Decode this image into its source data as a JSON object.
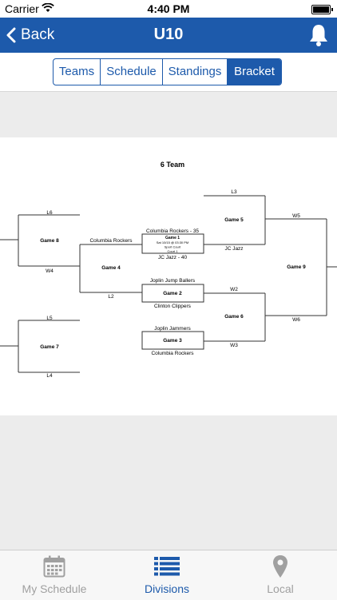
{
  "status_bar": {
    "carrier": "Carrier",
    "time": "4:40 PM"
  },
  "navbar": {
    "back_label": "Back",
    "title": "U10"
  },
  "segments": [
    {
      "label": "Teams",
      "active": false
    },
    {
      "label": "Schedule",
      "active": false
    },
    {
      "label": "Standings",
      "active": false
    },
    {
      "label": "Bracket",
      "active": true
    }
  ],
  "bracket": {
    "title": "6 Team",
    "games": {
      "game8": "Game 8",
      "game4": "Game 4",
      "game7": "Game 7",
      "game1": "Game 1",
      "game1_time": "Sat 10/15 @ 03:30 PM",
      "game1_venue": "Sport Court",
      "game1_court": "Court 1",
      "game2": "Game 2",
      "game3": "Game 3",
      "game5": "Game 5",
      "game6": "Game 6",
      "game9": "Game 9"
    },
    "labels": {
      "l6": "L6",
      "w4": "W4",
      "columbia_rockers_g4": "Columbia Rockers",
      "l2": "L2",
      "l5": "L5",
      "l4": "L4",
      "game1_top": "Columbia Rockers - 35",
      "game1_bottom": "JC Jazz - 40",
      "game2_top": "Joplin Jump Ballers",
      "game2_bottom": "Clinton Clippers",
      "game3_top": "Joplin Jammers",
      "game3_bottom": "Columbia Rockers",
      "l3": "L3",
      "jc_jazz": "JC Jazz",
      "w2": "W2",
      "w3": "W3",
      "w5": "W5",
      "w6": "W6"
    }
  },
  "tabbar": [
    {
      "label": "My Schedule",
      "icon": "calendar-icon",
      "active": false
    },
    {
      "label": "Divisions",
      "icon": "list-icon",
      "active": true
    },
    {
      "label": "Local",
      "icon": "location-pin-icon",
      "active": false
    }
  ],
  "colors": {
    "primary": "#1d5aab",
    "inactive": "#a0a0a0",
    "background_grey": "#ececec"
  }
}
